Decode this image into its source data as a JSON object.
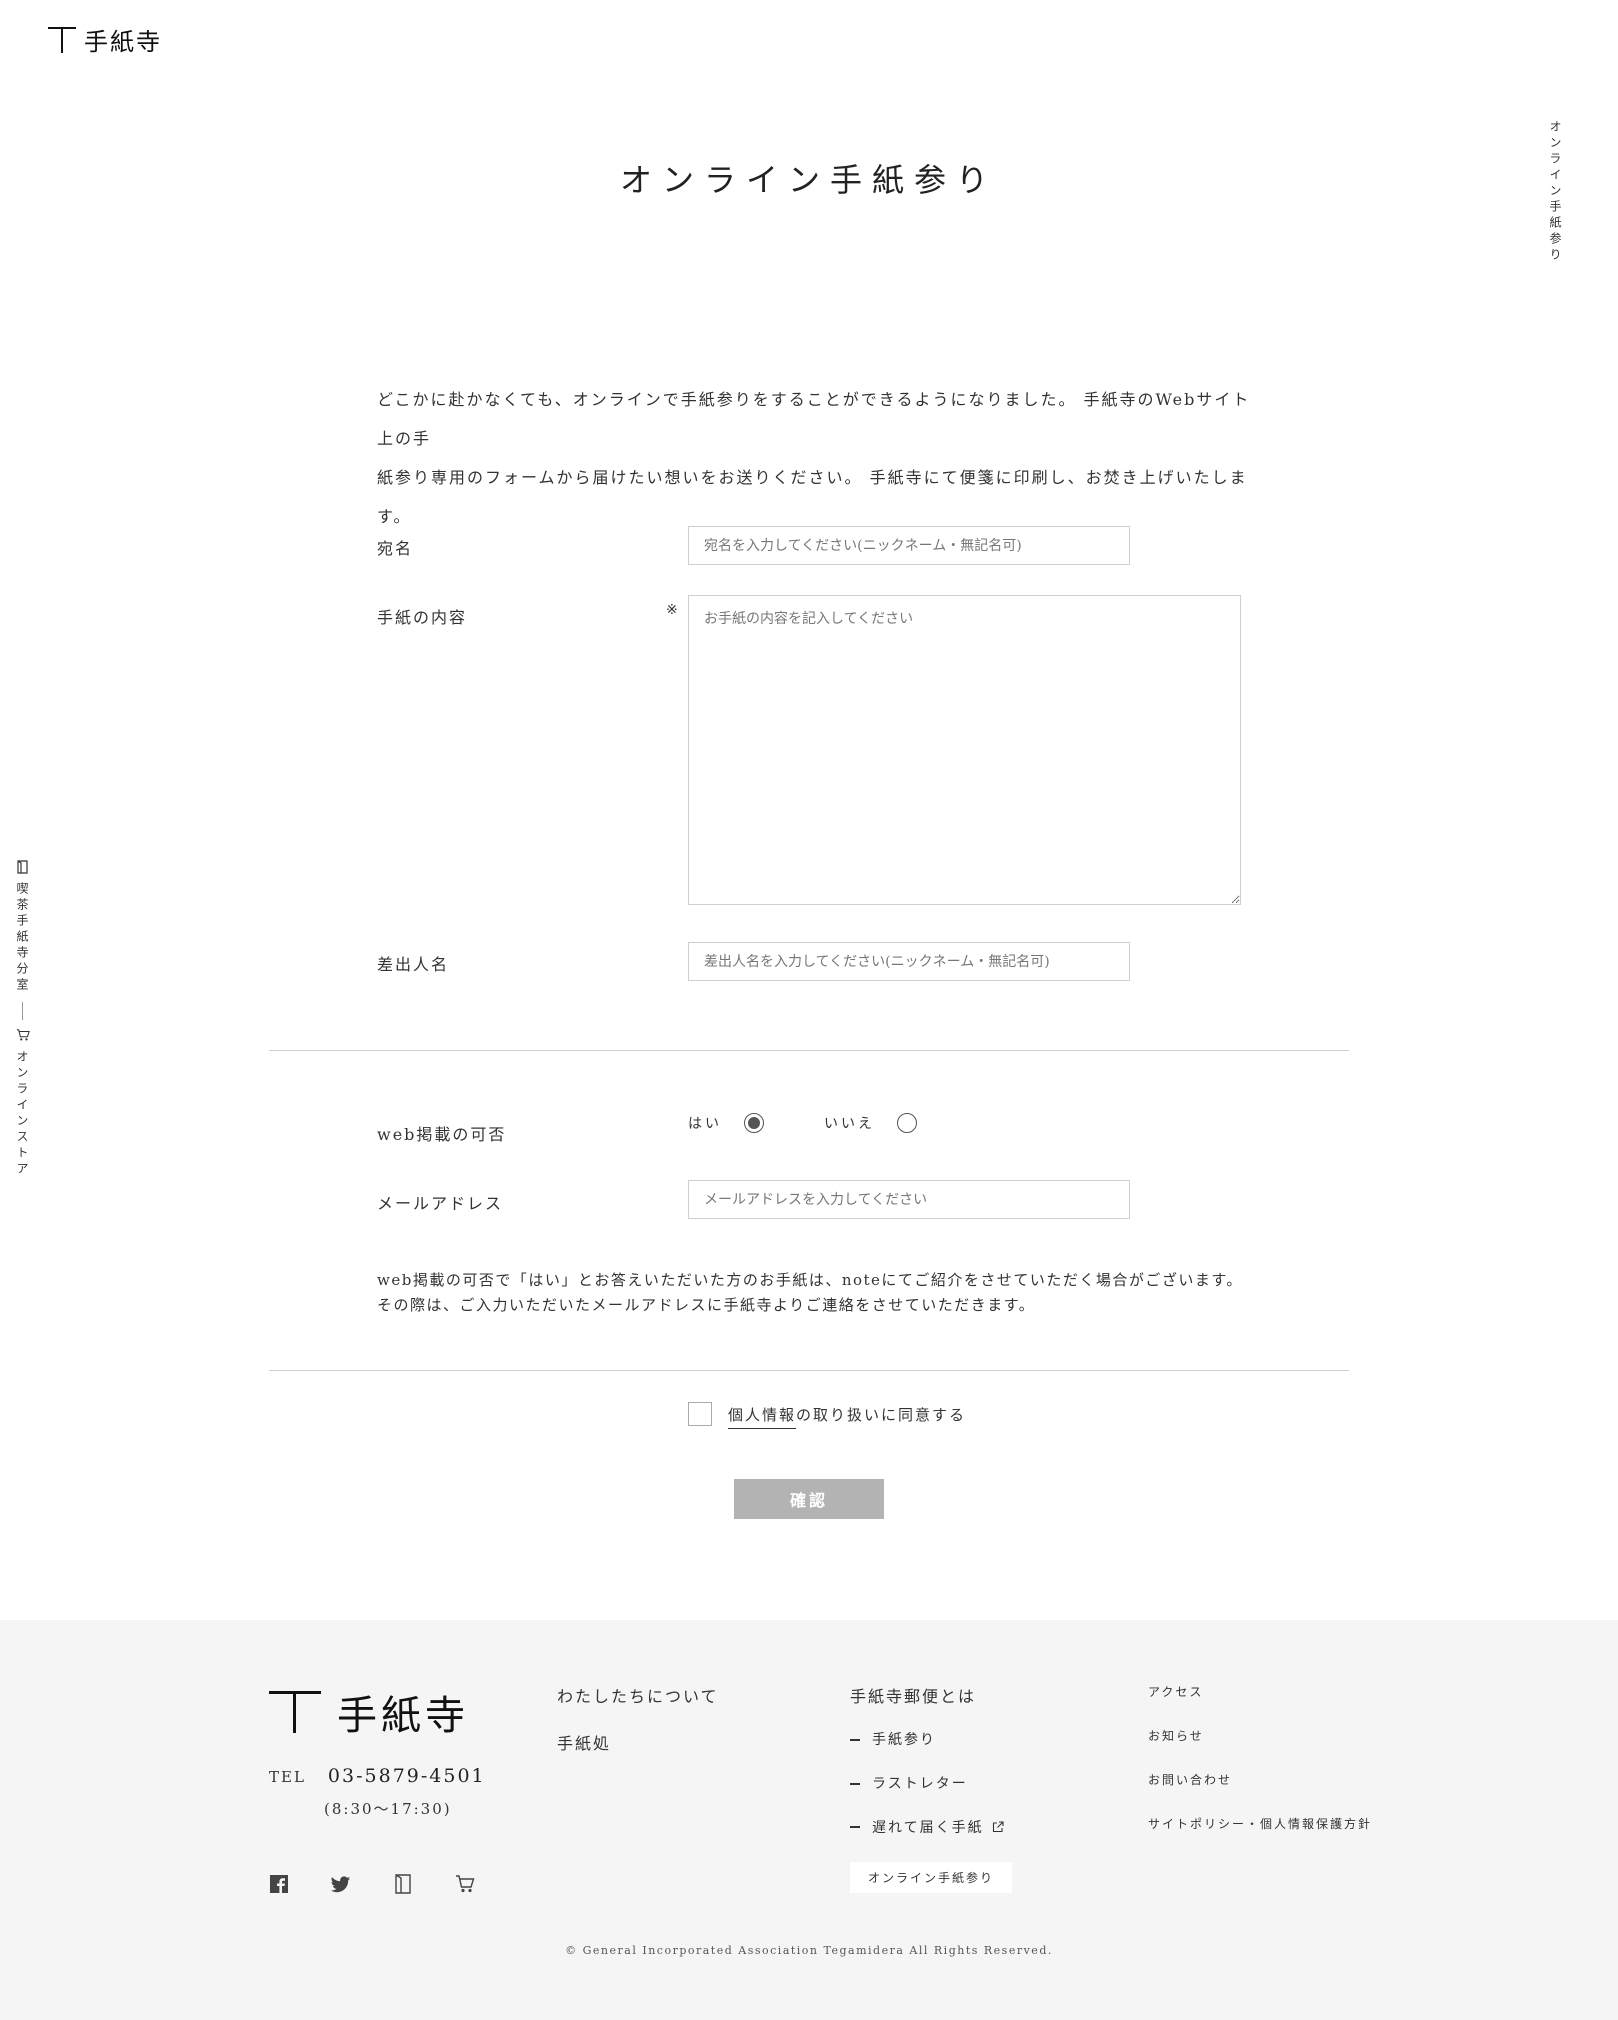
{
  "header": {
    "logo_text": "手紙寺",
    "side_right_text": "オンライン手紙参り",
    "side_left_cafe": "喫茶手紙寺分室",
    "side_left_store": "オンラインストア"
  },
  "page": {
    "title": "オンライン手紙参り",
    "intro_line1": "どこかに赴かなくても、オンラインで手紙参りをすることができるようになりました。 手紙寺のWebサイト上の手",
    "intro_line2": "紙参り専用のフォームから届けたい想いをお送りください。 手紙寺にて便箋に印刷し、お焚き上げいたします。"
  },
  "form": {
    "addressee_label": "宛名",
    "addressee_placeholder": "宛名を入力してください(ニックネーム・無記名可)",
    "content_label": "手紙の内容",
    "required_mark": "※",
    "content_placeholder": "お手紙の内容を記入してください",
    "sender_label": "差出人名",
    "sender_placeholder": "差出人名を入力してください(ニックネーム・無記名可)",
    "web_label": "web掲載の可否",
    "yes_label": "はい",
    "no_label": "いいえ",
    "email_label": "メールアドレス",
    "email_placeholder": "メールアドレスを入力してください",
    "note_line1": "web掲載の可否で「はい」とお答えいただいた方のお手紙は、noteにてご紹介をさせていただく場合がございます。",
    "note_line2": "その際は、ご入力いただいたメールアドレスに手紙寺よりご連絡をさせていただきます。",
    "agree_link": "個人情報",
    "agree_rest": "の取り扱いに同意する",
    "confirm_label": "確認"
  },
  "footer": {
    "logo_text": "手紙寺",
    "tel_label": "TEL",
    "tel_number": "03-5879-4501",
    "tel_hours": "(8:30〜17:30)",
    "col1": [
      "わたしたちについて",
      "手紙処"
    ],
    "col2_title": "手紙寺郵便とは",
    "col2_items": [
      "手紙参り",
      "ラストレター",
      "遅れて届く手紙"
    ],
    "online_button": "オンライン手紙参り",
    "col3": [
      "アクセス",
      "お知らせ",
      "お問い合わせ",
      "サイトポリシー・個人情報保護方針"
    ],
    "copyright": "© General Incorporated Association Tegamidera All Rights Reserved."
  },
  "icons": [
    "facebook-icon",
    "twitter-icon",
    "book-icon",
    "cart-icon",
    "external-link-icon"
  ]
}
